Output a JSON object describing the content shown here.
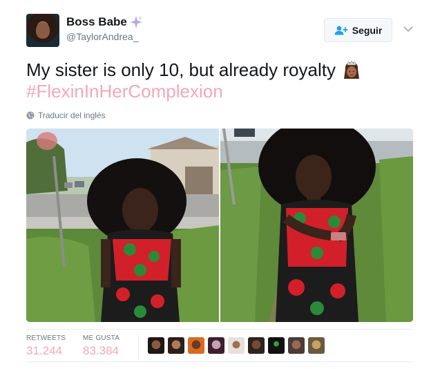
{
  "user": {
    "display_name": "Boss Babe",
    "handle": "@TaylorAndrea_"
  },
  "follow": {
    "label": "Seguir"
  },
  "tweet": {
    "line1": "My sister is only 10, but already royalty",
    "hashtag": "#FlexinInHerComplexion",
    "translate": "Traducir del inglés"
  },
  "stats": {
    "retweets_label": "RETWEETS",
    "retweets_value": "31.244",
    "likes_label": "ME GUSTA",
    "likes_value": "83.384"
  },
  "colors": {
    "accent_pink": "#f4a7b9",
    "secondary_text": "#657786",
    "border": "#e1e8ed"
  },
  "icons": {
    "sparkle": "sparkles-icon",
    "follow": "person-add-icon",
    "caret": "chevron-down-icon",
    "globe": "globe-icon",
    "emoji": "princess-emoji"
  },
  "liker_avatars_count": 9
}
